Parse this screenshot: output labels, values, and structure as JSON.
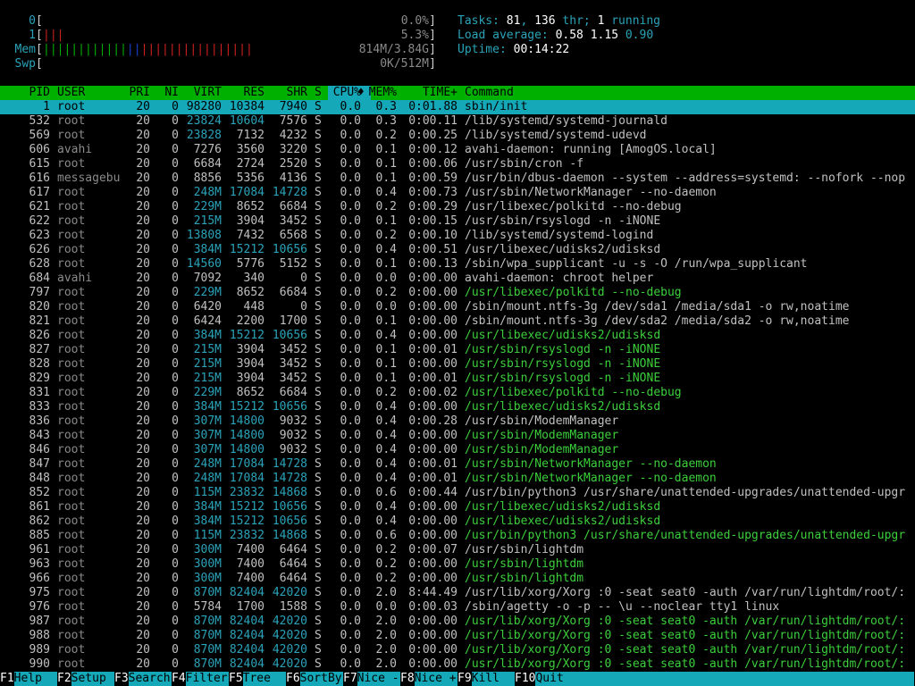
{
  "meters": [
    {
      "label": "0",
      "bars": [],
      "value": "0.0%"
    },
    {
      "label": "1",
      "bars": [
        {
          "c": "r",
          "n": 3
        }
      ],
      "value": "5.3%"
    },
    {
      "label": "Mem",
      "bars": [
        {
          "c": "g",
          "n": 12
        },
        {
          "c": "b",
          "n": 2
        },
        {
          "c": "r",
          "n": 16
        }
      ],
      "value": "814M/3.84G"
    },
    {
      "label": "Swp",
      "bars": [],
      "value": "0K/512M"
    }
  ],
  "stats": {
    "tasks_label": "Tasks: ",
    "tasks": "81",
    "tasks_sep": ", ",
    "thr": "136",
    "thr_label": " thr; ",
    "running": "1",
    "running_label": " running",
    "load_label": "Load average: ",
    "load1": "0.58",
    "load5": "1.15",
    "load15": "0.90",
    "uptime_label": "Uptime: ",
    "uptime": "00:14:22"
  },
  "columns": {
    "pid": "PID",
    "user": "USER",
    "pri": "PRI",
    "ni": "NI",
    "virt": "VIRT",
    "res": "RES",
    "shr": "SHR",
    "s": "S",
    "cpu": "CPU%",
    "sort_indicator": "♦",
    "mem": "MEM%",
    "time": "TIME+",
    "command": "Command"
  },
  "processes": [
    {
      "pid": "1",
      "user": "root",
      "pri": "20",
      "ni": "0",
      "virt": "98280",
      "res": "10384",
      "shr": "7940",
      "s": "S",
      "cpu": "0.0",
      "mem": "0.3",
      "time": "0:01.88",
      "command": "sbin/init",
      "selected": true,
      "thread": false
    },
    {
      "pid": "532",
      "user": "root",
      "pri": "20",
      "ni": "0",
      "virt": "23824",
      "res": "10604",
      "shr": "7576",
      "s": "S",
      "cpu": "0.0",
      "mem": "0.3",
      "time": "0:00.11",
      "command": "/lib/systemd/systemd-journald",
      "thread": false
    },
    {
      "pid": "569",
      "user": "root",
      "pri": "20",
      "ni": "0",
      "virt": "23828",
      "res": "7132",
      "shr": "4232",
      "s": "S",
      "cpu": "0.0",
      "mem": "0.2",
      "time": "0:00.25",
      "command": "/lib/systemd/systemd-udevd",
      "thread": false
    },
    {
      "pid": "606",
      "user": "avahi",
      "pri": "20",
      "ni": "0",
      "virt": "7276",
      "res": "3560",
      "shr": "3220",
      "s": "S",
      "cpu": "0.0",
      "mem": "0.1",
      "time": "0:00.12",
      "command": "avahi-daemon: running [AmogOS.local]",
      "thread": false
    },
    {
      "pid": "615",
      "user": "root",
      "pri": "20",
      "ni": "0",
      "virt": "6684",
      "res": "2724",
      "shr": "2520",
      "s": "S",
      "cpu": "0.0",
      "mem": "0.1",
      "time": "0:00.06",
      "command": "/usr/sbin/cron -f",
      "thread": false
    },
    {
      "pid": "616",
      "user": "messagebu",
      "pri": "20",
      "ni": "0",
      "virt": "8856",
      "res": "5356",
      "shr": "4136",
      "s": "S",
      "cpu": "0.0",
      "mem": "0.1",
      "time": "0:00.59",
      "command": "/usr/bin/dbus-daemon --system --address=systemd: --nofork --nop",
      "thread": false
    },
    {
      "pid": "617",
      "user": "root",
      "pri": "20",
      "ni": "0",
      "virt": "248M",
      "res": "17084",
      "shr": "14728",
      "s": "S",
      "cpu": "0.0",
      "mem": "0.4",
      "time": "0:00.73",
      "command": "/usr/sbin/NetworkManager --no-daemon",
      "thread": false
    },
    {
      "pid": "621",
      "user": "root",
      "pri": "20",
      "ni": "0",
      "virt": "229M",
      "res": "8652",
      "shr": "6684",
      "s": "S",
      "cpu": "0.0",
      "mem": "0.2",
      "time": "0:00.29",
      "command": "/usr/libexec/polkitd --no-debug",
      "thread": false
    },
    {
      "pid": "622",
      "user": "root",
      "pri": "20",
      "ni": "0",
      "virt": "215M",
      "res": "3904",
      "shr": "3452",
      "s": "S",
      "cpu": "0.0",
      "mem": "0.1",
      "time": "0:00.15",
      "command": "/usr/sbin/rsyslogd -n -iNONE",
      "thread": false
    },
    {
      "pid": "623",
      "user": "root",
      "pri": "20",
      "ni": "0",
      "virt": "13808",
      "res": "7432",
      "shr": "6568",
      "s": "S",
      "cpu": "0.0",
      "mem": "0.2",
      "time": "0:00.10",
      "command": "/lib/systemd/systemd-logind",
      "thread": false
    },
    {
      "pid": "626",
      "user": "root",
      "pri": "20",
      "ni": "0",
      "virt": "384M",
      "res": "15212",
      "shr": "10656",
      "s": "S",
      "cpu": "0.0",
      "mem": "0.4",
      "time": "0:00.51",
      "command": "/usr/libexec/udisks2/udisksd",
      "thread": false
    },
    {
      "pid": "628",
      "user": "root",
      "pri": "20",
      "ni": "0",
      "virt": "14560",
      "res": "5776",
      "shr": "5152",
      "s": "S",
      "cpu": "0.0",
      "mem": "0.1",
      "time": "0:00.13",
      "command": "/sbin/wpa_supplicant -u -s -O /run/wpa_supplicant",
      "thread": false
    },
    {
      "pid": "684",
      "user": "avahi",
      "pri": "20",
      "ni": "0",
      "virt": "7092",
      "res": "340",
      "shr": "0",
      "s": "S",
      "cpu": "0.0",
      "mem": "0.0",
      "time": "0:00.00",
      "command": "avahi-daemon: chroot helper",
      "thread": false
    },
    {
      "pid": "797",
      "user": "root",
      "pri": "20",
      "ni": "0",
      "virt": "229M",
      "res": "8652",
      "shr": "6684",
      "s": "S",
      "cpu": "0.0",
      "mem": "0.2",
      "time": "0:00.00",
      "command": "/usr/libexec/polkitd --no-debug",
      "thread": true
    },
    {
      "pid": "820",
      "user": "root",
      "pri": "20",
      "ni": "0",
      "virt": "6420",
      "res": "448",
      "shr": "0",
      "s": "S",
      "cpu": "0.0",
      "mem": "0.0",
      "time": "0:00.00",
      "command": "/sbin/mount.ntfs-3g /dev/sda1 /media/sda1 -o rw,noatime",
      "thread": false
    },
    {
      "pid": "821",
      "user": "root",
      "pri": "20",
      "ni": "0",
      "virt": "6424",
      "res": "2200",
      "shr": "1700",
      "s": "S",
      "cpu": "0.0",
      "mem": "0.1",
      "time": "0:00.00",
      "command": "/sbin/mount.ntfs-3g /dev/sda2 /media/sda2 -o rw,noatime",
      "thread": false
    },
    {
      "pid": "826",
      "user": "root",
      "pri": "20",
      "ni": "0",
      "virt": "384M",
      "res": "15212",
      "shr": "10656",
      "s": "S",
      "cpu": "0.0",
      "mem": "0.4",
      "time": "0:00.00",
      "command": "/usr/libexec/udisks2/udisksd",
      "thread": true
    },
    {
      "pid": "827",
      "user": "root",
      "pri": "20",
      "ni": "0",
      "virt": "215M",
      "res": "3904",
      "shr": "3452",
      "s": "S",
      "cpu": "0.0",
      "mem": "0.1",
      "time": "0:00.01",
      "command": "/usr/sbin/rsyslogd -n -iNONE",
      "thread": true
    },
    {
      "pid": "828",
      "user": "root",
      "pri": "20",
      "ni": "0",
      "virt": "215M",
      "res": "3904",
      "shr": "3452",
      "s": "S",
      "cpu": "0.0",
      "mem": "0.1",
      "time": "0:00.00",
      "command": "/usr/sbin/rsyslogd -n -iNONE",
      "thread": true
    },
    {
      "pid": "829",
      "user": "root",
      "pri": "20",
      "ni": "0",
      "virt": "215M",
      "res": "3904",
      "shr": "3452",
      "s": "S",
      "cpu": "0.0",
      "mem": "0.1",
      "time": "0:00.01",
      "command": "/usr/sbin/rsyslogd -n -iNONE",
      "thread": true
    },
    {
      "pid": "831",
      "user": "root",
      "pri": "20",
      "ni": "0",
      "virt": "229M",
      "res": "8652",
      "shr": "6684",
      "s": "S",
      "cpu": "0.0",
      "mem": "0.2",
      "time": "0:00.02",
      "command": "/usr/libexec/polkitd --no-debug",
      "thread": true
    },
    {
      "pid": "833",
      "user": "root",
      "pri": "20",
      "ni": "0",
      "virt": "384M",
      "res": "15212",
      "shr": "10656",
      "s": "S",
      "cpu": "0.0",
      "mem": "0.4",
      "time": "0:00.00",
      "command": "/usr/libexec/udisks2/udisksd",
      "thread": true
    },
    {
      "pid": "836",
      "user": "root",
      "pri": "20",
      "ni": "0",
      "virt": "307M",
      "res": "14800",
      "shr": "9032",
      "s": "S",
      "cpu": "0.0",
      "mem": "0.4",
      "time": "0:00.28",
      "command": "/usr/sbin/ModemManager",
      "thread": false
    },
    {
      "pid": "843",
      "user": "root",
      "pri": "20",
      "ni": "0",
      "virt": "307M",
      "res": "14800",
      "shr": "9032",
      "s": "S",
      "cpu": "0.0",
      "mem": "0.4",
      "time": "0:00.00",
      "command": "/usr/sbin/ModemManager",
      "thread": true
    },
    {
      "pid": "846",
      "user": "root",
      "pri": "20",
      "ni": "0",
      "virt": "307M",
      "res": "14800",
      "shr": "9032",
      "s": "S",
      "cpu": "0.0",
      "mem": "0.4",
      "time": "0:00.00",
      "command": "/usr/sbin/ModemManager",
      "thread": true
    },
    {
      "pid": "847",
      "user": "root",
      "pri": "20",
      "ni": "0",
      "virt": "248M",
      "res": "17084",
      "shr": "14728",
      "s": "S",
      "cpu": "0.0",
      "mem": "0.4",
      "time": "0:00.01",
      "command": "/usr/sbin/NetworkManager --no-daemon",
      "thread": true
    },
    {
      "pid": "848",
      "user": "root",
      "pri": "20",
      "ni": "0",
      "virt": "248M",
      "res": "17084",
      "shr": "14728",
      "s": "S",
      "cpu": "0.0",
      "mem": "0.4",
      "time": "0:00.01",
      "command": "/usr/sbin/NetworkManager --no-daemon",
      "thread": true
    },
    {
      "pid": "852",
      "user": "root",
      "pri": "20",
      "ni": "0",
      "virt": "115M",
      "res": "23832",
      "shr": "14868",
      "s": "S",
      "cpu": "0.0",
      "mem": "0.6",
      "time": "0:00.44",
      "command": "/usr/bin/python3 /usr/share/unattended-upgrades/unattended-upgr",
      "thread": false
    },
    {
      "pid": "861",
      "user": "root",
      "pri": "20",
      "ni": "0",
      "virt": "384M",
      "res": "15212",
      "shr": "10656",
      "s": "S",
      "cpu": "0.0",
      "mem": "0.4",
      "time": "0:00.00",
      "command": "/usr/libexec/udisks2/udisksd",
      "thread": true
    },
    {
      "pid": "862",
      "user": "root",
      "pri": "20",
      "ni": "0",
      "virt": "384M",
      "res": "15212",
      "shr": "10656",
      "s": "S",
      "cpu": "0.0",
      "mem": "0.4",
      "time": "0:00.00",
      "command": "/usr/libexec/udisks2/udisksd",
      "thread": true
    },
    {
      "pid": "885",
      "user": "root",
      "pri": "20",
      "ni": "0",
      "virt": "115M",
      "res": "23832",
      "shr": "14868",
      "s": "S",
      "cpu": "0.0",
      "mem": "0.6",
      "time": "0:00.00",
      "command": "/usr/bin/python3 /usr/share/unattended-upgrades/unattended-upgr",
      "thread": true
    },
    {
      "pid": "961",
      "user": "root",
      "pri": "20",
      "ni": "0",
      "virt": "300M",
      "res": "7400",
      "shr": "6464",
      "s": "S",
      "cpu": "0.0",
      "mem": "0.2",
      "time": "0:00.07",
      "command": "/usr/sbin/lightdm",
      "thread": false
    },
    {
      "pid": "963",
      "user": "root",
      "pri": "20",
      "ni": "0",
      "virt": "300M",
      "res": "7400",
      "shr": "6464",
      "s": "S",
      "cpu": "0.0",
      "mem": "0.2",
      "time": "0:00.00",
      "command": "/usr/sbin/lightdm",
      "thread": true
    },
    {
      "pid": "966",
      "user": "root",
      "pri": "20",
      "ni": "0",
      "virt": "300M",
      "res": "7400",
      "shr": "6464",
      "s": "S",
      "cpu": "0.0",
      "mem": "0.2",
      "time": "0:00.00",
      "command": "/usr/sbin/lightdm",
      "thread": true
    },
    {
      "pid": "975",
      "user": "root",
      "pri": "20",
      "ni": "0",
      "virt": "870M",
      "res": "82404",
      "shr": "42020",
      "s": "S",
      "cpu": "0.0",
      "mem": "2.0",
      "time": "8:44.49",
      "command": "/usr/lib/xorg/Xorg :0 -seat seat0 -auth /var/run/lightdm/root/:",
      "thread": false
    },
    {
      "pid": "976",
      "user": "root",
      "pri": "20",
      "ni": "0",
      "virt": "5784",
      "res": "1700",
      "shr": "1588",
      "s": "S",
      "cpu": "0.0",
      "mem": "0.0",
      "time": "0:00.03",
      "command": "/sbin/agetty -o -p -- \\u --noclear tty1 linux",
      "thread": false
    },
    {
      "pid": "987",
      "user": "root",
      "pri": "20",
      "ni": "0",
      "virt": "870M",
      "res": "82404",
      "shr": "42020",
      "s": "S",
      "cpu": "0.0",
      "mem": "2.0",
      "time": "0:00.00",
      "command": "/usr/lib/xorg/Xorg :0 -seat seat0 -auth /var/run/lightdm/root/:",
      "thread": true
    },
    {
      "pid": "988",
      "user": "root",
      "pri": "20",
      "ni": "0",
      "virt": "870M",
      "res": "82404",
      "shr": "42020",
      "s": "S",
      "cpu": "0.0",
      "mem": "2.0",
      "time": "0:00.00",
      "command": "/usr/lib/xorg/Xorg :0 -seat seat0 -auth /var/run/lightdm/root/:",
      "thread": true
    },
    {
      "pid": "989",
      "user": "root",
      "pri": "20",
      "ni": "0",
      "virt": "870M",
      "res": "82404",
      "shr": "42020",
      "s": "S",
      "cpu": "0.0",
      "mem": "2.0",
      "time": "0:00.00",
      "command": "/usr/lib/xorg/Xorg :0 -seat seat0 -auth /var/run/lightdm/root/:",
      "thread": true
    },
    {
      "pid": "990",
      "user": "root",
      "pri": "20",
      "ni": "0",
      "virt": "870M",
      "res": "82404",
      "shr": "42020",
      "s": "S",
      "cpu": "0.0",
      "mem": "2.0",
      "time": "0:00.00",
      "command": "/usr/lib/xorg/Xorg :0 -seat seat0 -auth /var/run/lightdm/root/:",
      "thread": true
    }
  ],
  "footer": [
    {
      "key": "F1",
      "label": "Help"
    },
    {
      "key": "F2",
      "label": "Setup"
    },
    {
      "key": "F3",
      "label": "Search"
    },
    {
      "key": "F4",
      "label": "Filter"
    },
    {
      "key": "F5",
      "label": "Tree"
    },
    {
      "key": "F6",
      "label": "SortBy"
    },
    {
      "key": "F7",
      "label": "Nice -"
    },
    {
      "key": "F8",
      "label": "Nice +"
    },
    {
      "key": "F9",
      "label": "Kill"
    },
    {
      "key": "F10",
      "label": "Quit"
    }
  ],
  "colors": {
    "header_bg": "#00b000",
    "selected_bg": "#14a8b8",
    "thread_fg": "#3ccf3c",
    "label_fg": "#2aa3b8"
  }
}
